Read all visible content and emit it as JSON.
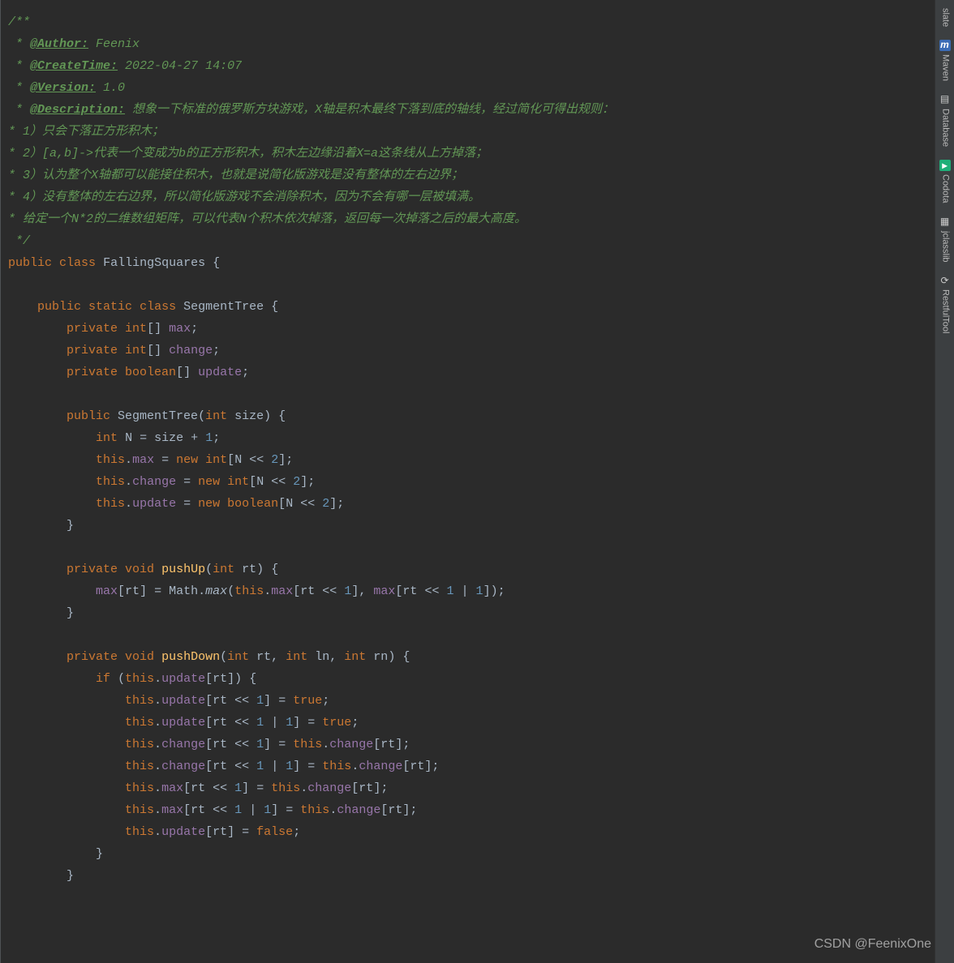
{
  "sidebar": {
    "items": [
      {
        "label": "slate",
        "icon": ""
      },
      {
        "label": "Maven",
        "icon": "m"
      },
      {
        "label": "Database",
        "icon": "▤"
      },
      {
        "label": "Codota",
        "icon": "▸"
      },
      {
        "label": "jclasslib",
        "icon": "▦"
      },
      {
        "label": "RestfulTool",
        "icon": "⟳"
      }
    ]
  },
  "watermark": "CSDN @FeenixOne",
  "code": {
    "doc_open": "/**",
    "doc_prefix": " * ",
    "doc_tag_author": "@Author:",
    "doc_author_val": " Feenix",
    "doc_tag_create": "@CreateTime:",
    "doc_create_val": " 2022-04-27 14:07",
    "doc_tag_version": "@Version:",
    "doc_version_val": " 1.0",
    "doc_tag_desc": "@Description:",
    "doc_desc_l0": " 想象一下标准的俄罗斯方块游戏，X轴是积木最终下落到底的轴线，经过简化可得出规则：",
    "doc_desc_l1": "* 1）只会下落正方形积木；",
    "doc_desc_l2": "* 2）[a,b]->代表一个变成为b的正方形积木，积木左边缘沿着X=a这条线从上方掉落；",
    "doc_desc_l3": "* 3）认为整个X轴都可以能接住积木，也就是说简化版游戏是没有整体的左右边界；",
    "doc_desc_l4": "* 4）没有整体的左右边界，所以简化版游戏不会消除积木，因为不会有哪一层被填满。",
    "doc_desc_l5": "* 给定一个N*2的二维数组矩阵，可以代表N个积木依次掉落，返回每一次掉落之后的最大高度。",
    "doc_close": " */",
    "kw_public": "public",
    "kw_class": "class",
    "kw_static": "static",
    "kw_private": "private",
    "kw_int": "int",
    "kw_boolean": "boolean",
    "kw_void": "void",
    "kw_new": "new",
    "kw_this": "this",
    "kw_if": "if",
    "kw_true": "true",
    "kw_false": "false",
    "cls_FallingSquares": "FallingSquares",
    "cls_SegmentTree": "SegmentTree",
    "cls_Math": "Math",
    "fld_max": "max",
    "fld_change": "change",
    "fld_update": "update",
    "mth_pushUp": "pushUp",
    "mth_pushDown": "pushDown",
    "mth_mathmax": "max",
    "var_size": "size",
    "var_N": "N",
    "var_rt": "rt",
    "var_ln": "ln",
    "var_rn": "rn",
    "num_1": "1",
    "num_2": "2",
    "op_shl": "<<",
    "op_or": "|",
    "op_eq": "=",
    "op_plus": "+",
    "brace_open": "{",
    "brace_close": "}",
    "paren_open": "(",
    "paren_close": ")",
    "bracket_open": "[",
    "bracket_close": "]",
    "brackets_empty": "[]",
    "semi": ";",
    "comma": ",",
    "dot": "."
  }
}
